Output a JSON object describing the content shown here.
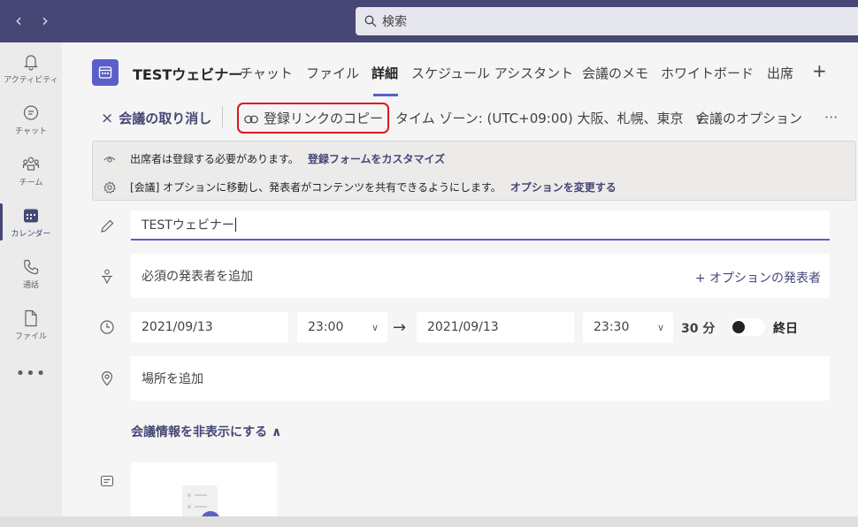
{
  "topbar": {
    "search_placeholder": "検索",
    "back_icon": "chevron-left-icon",
    "forward_icon": "chevron-right-icon",
    "color": "#464775"
  },
  "rail": {
    "items": [
      {
        "label": "アクティビティ",
        "icon": "bell-icon"
      },
      {
        "label": "チャット",
        "icon": "chat-icon"
      },
      {
        "label": "チーム",
        "icon": "teams-icon"
      },
      {
        "label": "カレンダー",
        "icon": "calendar-icon",
        "active": true
      },
      {
        "label": "通話",
        "icon": "phone-icon"
      },
      {
        "label": "ファイル",
        "icon": "file-icon"
      }
    ],
    "more": "•••"
  },
  "header": {
    "meeting_title": "TESTウェビナー",
    "tabs": [
      {
        "label": "チャット"
      },
      {
        "label": "ファイル"
      },
      {
        "label": "詳細",
        "active": true
      },
      {
        "label": "スケジュール アシスタント"
      },
      {
        "label": "会議のメモ"
      },
      {
        "label": "ホワイトボード"
      },
      {
        "label": "出席"
      }
    ],
    "add_tab": "+"
  },
  "actions": {
    "cancel_icon": "×",
    "cancel": "会議の取り消し",
    "copy_link": "登録リンクのコピー",
    "timezone": "タイム ゾーン: (UTC+09:00) 大阪、札幌、東京",
    "timezone_chevron": "∨",
    "options": "会議のオプション",
    "more": "···"
  },
  "info": {
    "line1_text": "出席者は登録する必要があります。",
    "line1_link": "登録フォームをカスタマイズ",
    "line2_text": "[会議] オプションに移動し、発表者がコンテンツを共有できるようにします。",
    "line2_link": "オプションを変更する"
  },
  "form": {
    "title_value": "TESTウェビナー",
    "presenters_placeholder": "必須の発表者を追加",
    "optional_presenters": "+ オプションの発表者",
    "start_date": "2021/09/13",
    "start_time": "23:00",
    "end_date": "2021/09/13",
    "end_time": "23:30",
    "duration": "30 分",
    "all_day": "終日",
    "all_day_on": false,
    "location_placeholder": "場所を追加",
    "hide_info": "会議情報を非表示にする ∧"
  },
  "colors": {
    "accent": "#5b5fc7",
    "brand": "#464775",
    "highlight": "#e0141e"
  }
}
